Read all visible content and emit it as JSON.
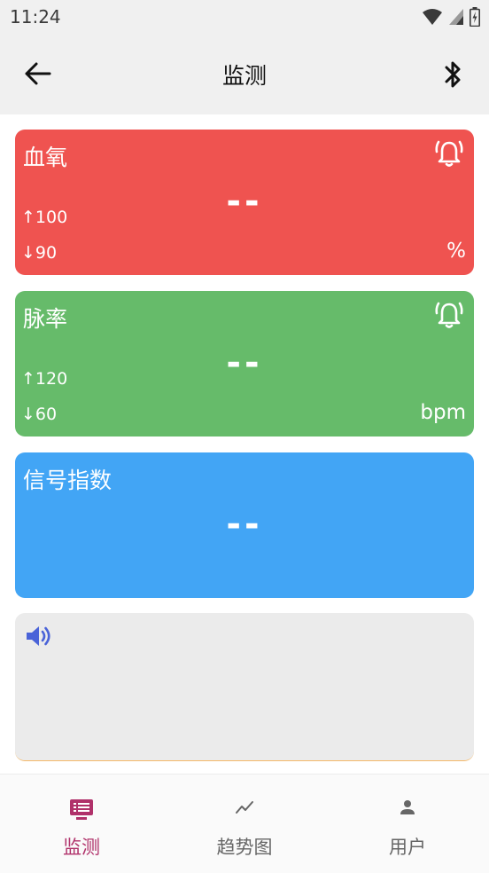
{
  "status_bar": {
    "time": "11:24",
    "icons": [
      "wifi-icon",
      "signal-icon",
      "battery-charging-icon"
    ]
  },
  "app_bar": {
    "title": "监测",
    "left_icon": "arrow-back-icon",
    "right_icon": "bluetooth-icon"
  },
  "cards": {
    "spo2": {
      "name": "血氧",
      "value": "--",
      "upper": "↑100",
      "lower": "↓90",
      "unit": "%",
      "icon": "alarm-bell-icon",
      "color": "#ef5350"
    },
    "pulse": {
      "name": "脉率",
      "value": "--",
      "upper": "↑120",
      "lower": "↓60",
      "unit": "bpm",
      "icon": "alarm-bell-icon",
      "color": "#66bb6a"
    },
    "signal": {
      "name": "信号指数",
      "value": "--",
      "color": "#42a5f5"
    },
    "waveform": {
      "icon": "volume-icon",
      "color": "#ebebeb"
    }
  },
  "bottom_nav": {
    "items": [
      {
        "label": "监测",
        "icon": "monitor-list-icon",
        "active": true
      },
      {
        "label": "趋势图",
        "icon": "trend-chart-icon",
        "active": false
      },
      {
        "label": "用户",
        "icon": "person-icon",
        "active": false
      }
    ],
    "accent": "#b0316a"
  }
}
